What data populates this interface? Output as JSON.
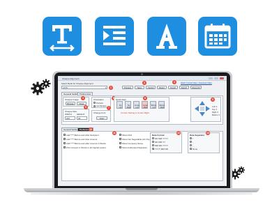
{
  "colors": {
    "tile": "#1e8fe0",
    "badge": "#e74c3c",
    "gear": "#1a1a1a"
  },
  "feature_icons": [
    "text-tool-icon",
    "indent-list-icon",
    "font-a-icon",
    "calendar-icon"
  ],
  "decor_icons": [
    "gears-icon",
    "gears-icon"
  ],
  "app": {
    "title": "Cheque Alignment",
    "select_label": "Select Bank for Cheque Alignment",
    "select_value": "AXIS",
    "toolbar": [
      "Preview",
      "Save",
      "Cancel",
      "Reset",
      "Import",
      "Export",
      "Reset All"
    ],
    "help_link": "Watch Tutorial Video / Download Video",
    "tabs": [
      "General Setting",
      "Preferences"
    ],
    "cheque_image": {
      "label": "Cheque Image",
      "browse": "Browse",
      "clear": "Clear"
    },
    "cheque_size": {
      "label": "Cheque Size",
      "width_label": "WIDTH",
      "height_label": "HEIGHT",
      "width": "202",
      "height": "92"
    },
    "orientation": {
      "label": "Orientation",
      "options": [
        "Portrait",
        "Landscape"
      ],
      "selected": "Landscape"
    },
    "change_font": {
      "label": "Change Font",
      "button": "Font"
    },
    "quick_align": {
      "label": "Quick Align",
      "cells": [
        "Top Left",
        "Top Right",
        "Center Left",
        "Center Right",
        "Bottom Left",
        "Bottom Right"
      ],
      "note": "Current Setting is Center Right"
    },
    "margins": {
      "left": "Left: 0",
      "top": "Top: 0",
      "right": "Right: 0",
      "bottom": "Bottom: 0"
    },
    "lower_tabs": [
      "General Setting",
      "Preferences"
    ],
    "options": [
      "Add **** Before and After Recipient",
      "Add **** Before and After Amount",
      "Add **** Before and after Amount in Words",
      "Print Amount in Words in all Capital Letters"
    ],
    "options_mid": [
      "Show Grid",
      "Show Not Negotiable A/C Payee Only",
      "Show Company Name",
      "Show Authorised Signatory"
    ],
    "date_format": {
      "label": "Date Format",
      "options": [
        "DD MM YYYY",
        "DD MM YY",
        "MM DD YYYY",
        "YYYY MM DD"
      ]
    },
    "date_separator": {
      "label": "Date Separator",
      "options": [
        "/",
        "-",
        ".",
        "None"
      ],
      "selected": "None"
    },
    "badges": [
      "1",
      "2",
      "3",
      "4",
      "5",
      "6",
      "7",
      "8",
      "9",
      "10",
      "11",
      "12",
      "13",
      "14"
    ]
  }
}
